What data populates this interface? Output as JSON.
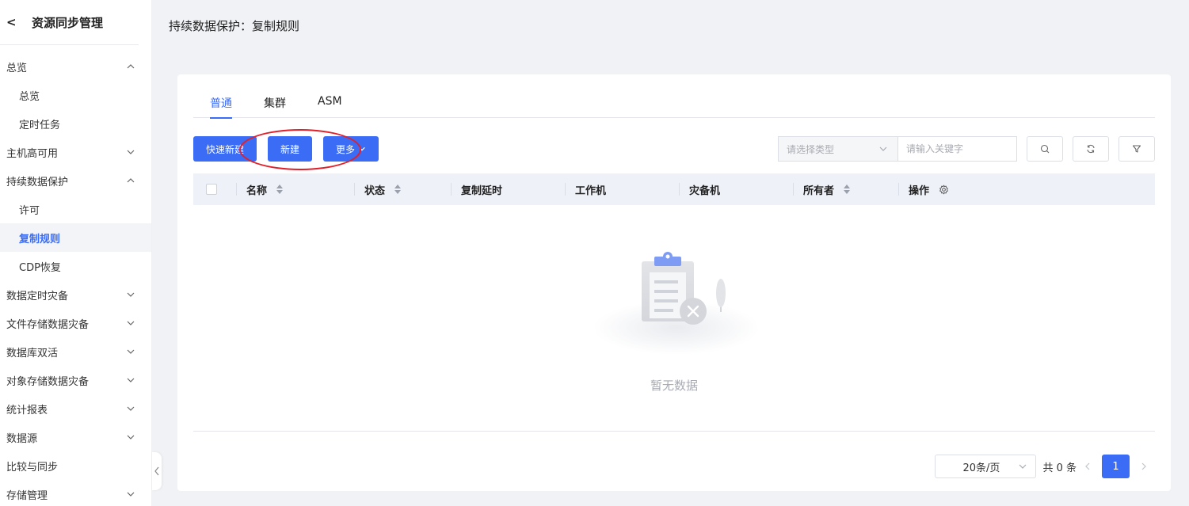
{
  "sidebar": {
    "back_label": "<",
    "title": "资源同步管理",
    "items": [
      {
        "label": "总览",
        "chevron": "up"
      },
      {
        "label": "总览"
      },
      {
        "label": "定时任务"
      },
      {
        "label": "主机高可用",
        "chevron": "down"
      },
      {
        "label": "持续数据保护",
        "chevron": "up"
      },
      {
        "label": "许可"
      },
      {
        "label": "复制规则"
      },
      {
        "label": "CDP恢复"
      },
      {
        "label": "数据定时灾备",
        "chevron": "down"
      },
      {
        "label": "文件存储数据灾备",
        "chevron": "down"
      },
      {
        "label": "数据库双活",
        "chevron": "down"
      },
      {
        "label": "对象存储数据灾备",
        "chevron": "down"
      },
      {
        "label": "统计报表",
        "chevron": "down"
      },
      {
        "label": "数据源",
        "chevron": "down"
      },
      {
        "label": "比较与同步"
      },
      {
        "label": "存储管理",
        "chevron": "down"
      }
    ]
  },
  "header": {
    "title": "持续数据保护：复制规则"
  },
  "tabs": [
    {
      "label": "普通"
    },
    {
      "label": "集群"
    },
    {
      "label": "ASM"
    }
  ],
  "toolbar": {
    "quick_new": "快速新建",
    "new": "新建",
    "more": "更多"
  },
  "filters": {
    "type_placeholder": "请选择类型",
    "keyword_placeholder": "请输入关键字"
  },
  "table": {
    "columns": [
      {
        "label": "名称"
      },
      {
        "label": "状态"
      },
      {
        "label": "复制延时"
      },
      {
        "label": "工作机"
      },
      {
        "label": "灾备机"
      },
      {
        "label": "所有者"
      },
      {
        "label": "操作"
      }
    ],
    "empty_text": "暂无数据"
  },
  "pagination": {
    "page_size": "20条/页",
    "total": "共 0 条",
    "current_page": "1"
  },
  "colors": {
    "accent": "#3b6cf5",
    "annotation": "#e0202a"
  }
}
